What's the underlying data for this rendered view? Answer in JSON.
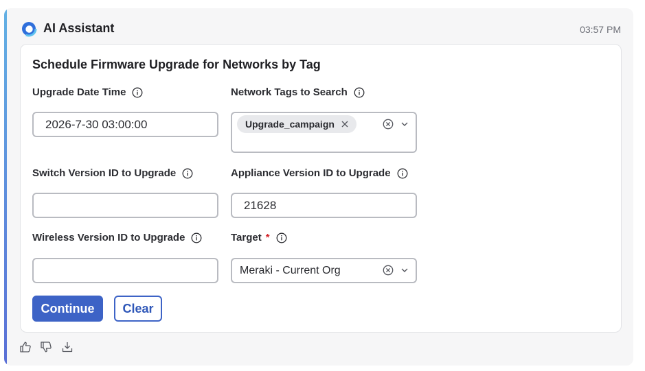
{
  "header": {
    "title": "AI Assistant",
    "timestamp": "03:57 PM",
    "logo_icon": "ai-assistant-logo-icon"
  },
  "form": {
    "title": "Schedule Firmware Upgrade for Networks by Tag",
    "fields": {
      "upgrade_date_time": {
        "label": "Upgrade Date Time",
        "value": "2026-7-30 03:00:00"
      },
      "network_tags": {
        "label": "Network Tags to Search",
        "tags": [
          "Upgrade_campaign"
        ]
      },
      "switch_version": {
        "label": "Switch Version ID to Upgrade",
        "value": ""
      },
      "appliance_version": {
        "label": "Appliance Version ID to Upgrade",
        "value": "21628"
      },
      "wireless_version": {
        "label": "Wireless Version ID to Upgrade",
        "value": ""
      },
      "target": {
        "label": "Target",
        "required_marker": "*",
        "value": "Meraki - Current Org"
      }
    },
    "buttons": {
      "continue_label": "Continue",
      "clear_label": "Clear"
    }
  },
  "feedback": {
    "icons": [
      "thumbs-up-icon",
      "thumbs-down-icon",
      "download-icon"
    ]
  },
  "colors": {
    "accent_blue": "#3d63c6",
    "accent_bar_top": "#63b1e4",
    "accent_bar_bottom": "#5a6fd6",
    "required_red": "#d3262c"
  }
}
